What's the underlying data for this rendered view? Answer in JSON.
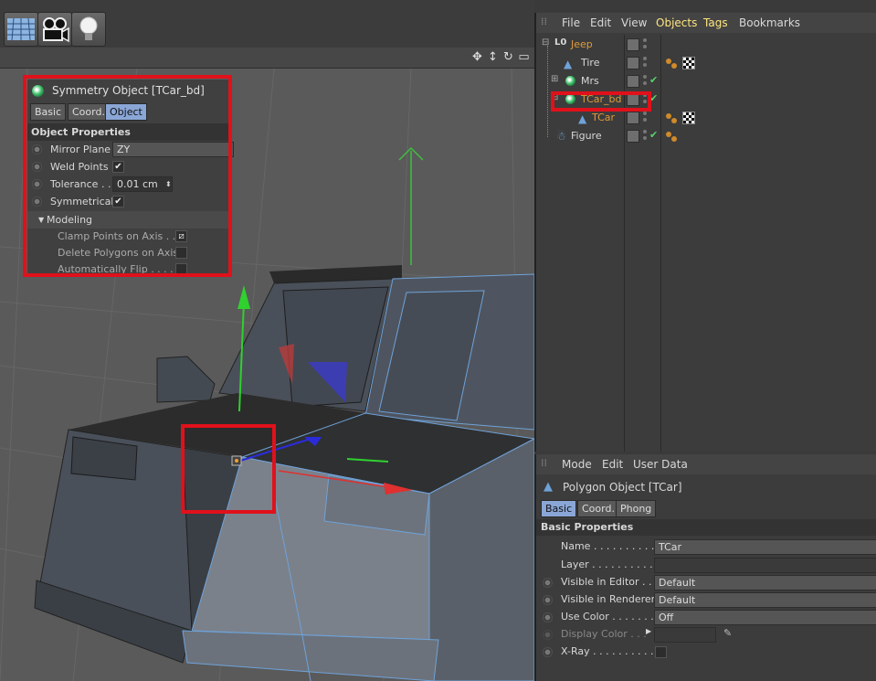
{
  "toolbar": {
    "icons": [
      "grid-floor-icon",
      "camera-icon",
      "light-bulb-icon"
    ]
  },
  "viewport": {
    "nav_icons": [
      "move-view-icon",
      "zoom-view-icon",
      "rotate-view-icon",
      "maximize-view-icon"
    ]
  },
  "symmetry_panel": {
    "title": "Symmetry Object [TCar_bd]",
    "tabs": [
      "Basic",
      "Coord.",
      "Object"
    ],
    "active_tab": "Object",
    "section": "Object Properties",
    "mirror_plane_label": "Mirror Plane",
    "mirror_plane_value": "ZY",
    "weld_points_label": "Weld Points",
    "weld_points_checked": true,
    "tolerance_label": "Tolerance . .",
    "tolerance_value": "0.01 cm",
    "symmetrical_label": "Symmetrical",
    "symmetrical_checked": true,
    "modeling_group": "Modeling",
    "clamp_label": "Clamp Points on Axis . .",
    "delete_label": "Delete Polygons on Axis",
    "flip_label": "Automatically Flip . . . . ."
  },
  "object_manager": {
    "menu": [
      "File",
      "Edit",
      "View",
      "Objects",
      "Tags",
      "Bookmarks"
    ],
    "objects": [
      {
        "name": "Jeep",
        "color": "#e09a3a"
      },
      {
        "name": "Tire",
        "color": "#d8d8d8"
      },
      {
        "name": "Mrs",
        "color": "#d8d8d8"
      },
      {
        "name": "TCar_bd",
        "color": "#e09a3a"
      },
      {
        "name": "TCar",
        "color": "#e09a3a"
      },
      {
        "name": "Figure",
        "color": "#d8d8d8"
      }
    ]
  },
  "attribute_manager": {
    "menu": [
      "Mode",
      "Edit",
      "User Data"
    ],
    "title": "Polygon Object [TCar]",
    "tabs": [
      "Basic",
      "Coord.",
      "Phong"
    ],
    "section": "Basic Properties",
    "name_label": "Name . . . . . . . . . . .",
    "name_value": "TCar",
    "layer_label": "Layer . . . . . . . . . . .",
    "visible_editor_label": "Visible in Editor . . .",
    "visible_editor_value": "Default",
    "visible_renderer_label": "Visible in Renderer",
    "visible_renderer_value": "Default",
    "use_color_label": "Use Color . . . . . . . .",
    "use_color_value": "Off",
    "display_color_label": "Display Color . . .",
    "xray_label": "X-Ray . . . . . . . . . . ."
  },
  "colors": {
    "highlight": "#e0111b",
    "accent_tab": "#8aa6d6",
    "selected_object": "#e09a3a"
  }
}
